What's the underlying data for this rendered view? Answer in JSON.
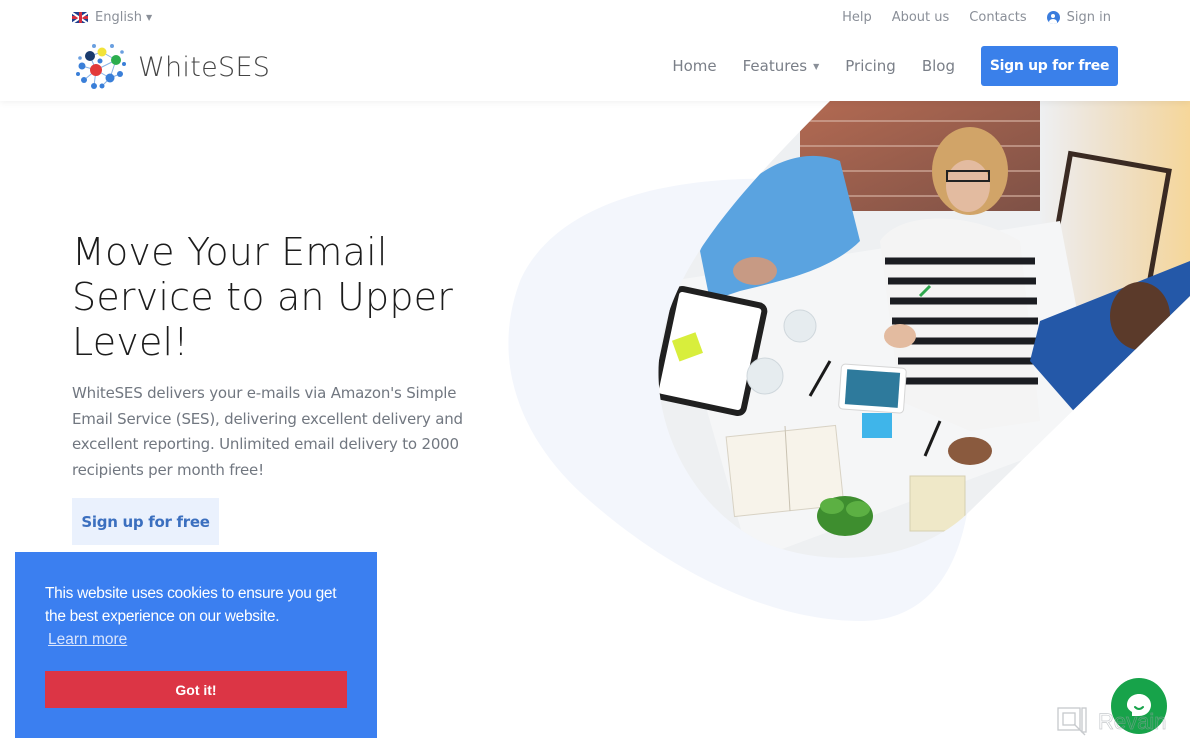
{
  "header": {
    "language": {
      "label": "English",
      "flag": "uk-flag"
    },
    "top_links": [
      {
        "label": "Help"
      },
      {
        "label": "About us"
      },
      {
        "label": "Contacts"
      }
    ],
    "sign_in": {
      "label": "Sign in",
      "icon": "user-circle-icon"
    },
    "brand": {
      "name": "WhiteSES"
    },
    "nav": [
      {
        "label": "Home"
      },
      {
        "label": "Features",
        "has_dropdown": true
      },
      {
        "label": "Pricing"
      },
      {
        "label": "Blog"
      }
    ],
    "cta_label": "Sign up for free"
  },
  "hero": {
    "title": "Move Your Email Service to an Upper Level!",
    "description": "WhiteSES delivers your e-mails via Amazon's Simple Email Service (SES), delivering excellent delivery and excellent reporting. Unlimited email delivery to 2000 recipients per month free!",
    "cta_label": "Sign up for free",
    "image_alt": "Team meeting around a table with laptops, tablets and notebooks"
  },
  "cookie_banner": {
    "message": "This website uses cookies to ensure you get the best experience on our website.",
    "learn_more": "Learn more",
    "accept_label": "Got it!"
  },
  "chat_widget": {
    "icon": "chat-bubble-icon"
  },
  "watermark": {
    "text": "Revain"
  },
  "colors": {
    "primary": "#3a80ea",
    "cookie_bg": "#3b7ff0",
    "accept_red": "#dc3545",
    "chat_green": "#17a34a",
    "light_button_bg": "#eaf1fd"
  }
}
